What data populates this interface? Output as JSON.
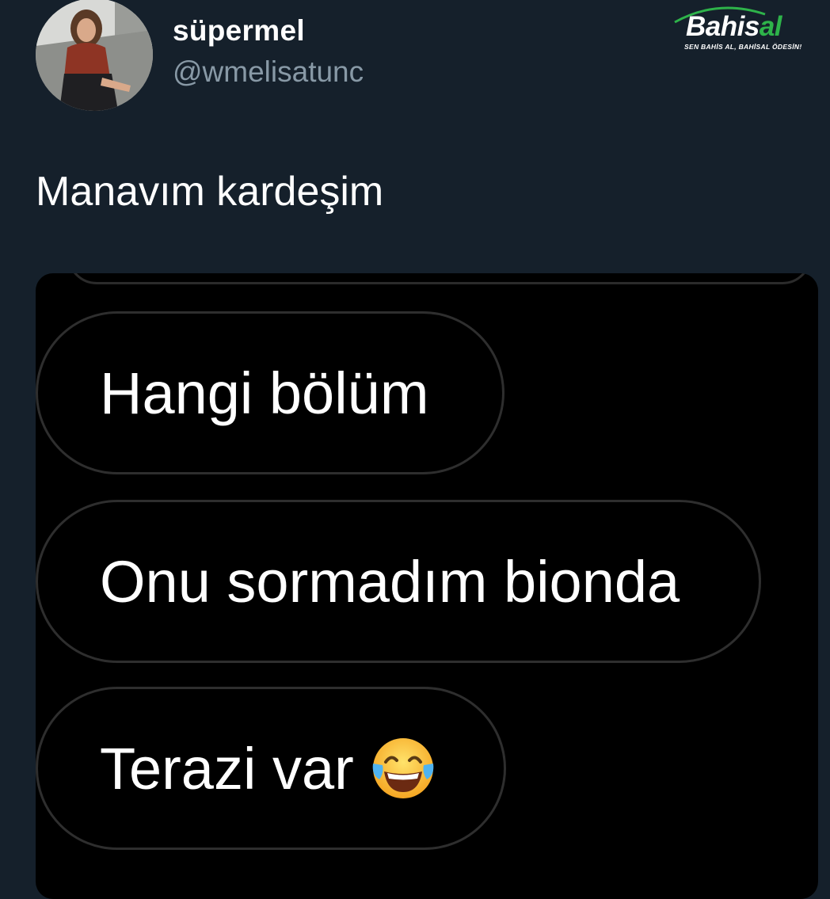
{
  "tweet": {
    "display_name": "süpermel",
    "handle": "@wmelisatunc",
    "text": "Manavım kardeşim",
    "avatar_icon": "profile-photo"
  },
  "logo": {
    "name_part1": "Bahis",
    "name_part2": "al",
    "slogan": "SEN BAHİS AL, BAHİSAL ÖDESİN!",
    "green": "#2eb34a"
  },
  "chat": {
    "messages": [
      {
        "text": "Hangi bölüm"
      },
      {
        "text": "Onu sormadım bionda"
      },
      {
        "text": "Terazi var",
        "emoji_icon": "face-with-tears-of-joy-icon"
      }
    ]
  },
  "colors": {
    "background": "#15202b",
    "handle_gray": "#8899a6",
    "media_black": "#000000"
  }
}
